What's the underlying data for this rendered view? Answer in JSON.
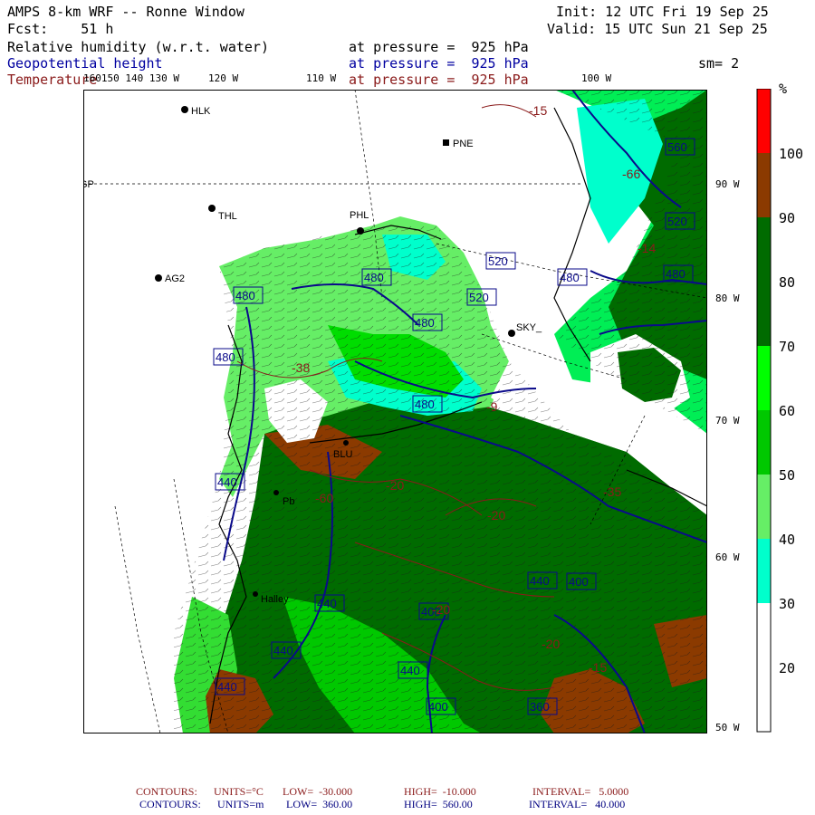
{
  "header": {
    "model": "AMPS 8-km WRF -- Ronne Window",
    "init": "Init: 12 UTC Fri 19 Sep 25",
    "forecast": "Fcst:    51 h",
    "valid": "Valid: 15 UTC Sun 21 Sep 25",
    "smoothing": "sm= 2"
  },
  "fields": [
    {
      "name": "Relative humidity (w.r.t. water)",
      "level": "at pressure =  925 hPa",
      "color": "#000000"
    },
    {
      "name": "Geopotential height",
      "level": "at pressure =  925 hPa",
      "color": "#0000a0"
    },
    {
      "name": "Temperature",
      "level": "at pressure =  925 hPa",
      "color": "#8a1a1a"
    }
  ],
  "lon_labels": [
    {
      "text": "160150 140 130 W"
    },
    {
      "text": "120 W"
    },
    {
      "text": "110 W"
    },
    {
      "text": "100 W"
    }
  ],
  "lat_labels": [
    "90 W",
    "80 W",
    "70 W",
    "60 W",
    "50 W"
  ],
  "stations": [
    {
      "id": "HLK",
      "label": "HLK"
    },
    {
      "id": "PNE",
      "label": "PNE"
    },
    {
      "id": "THL",
      "label": "THL"
    },
    {
      "id": "PHL",
      "label": "PHL"
    },
    {
      "id": "AG2",
      "label": "AG2"
    },
    {
      "id": "SKY",
      "label": "SKY_"
    },
    {
      "id": "BLU",
      "label": "BLU"
    },
    {
      "id": "PB",
      "label": "Pb"
    },
    {
      "id": "HAL",
      "label": "Halley"
    },
    {
      "id": "GP",
      "label": "GP"
    }
  ],
  "height_contour_labels": [
    "560",
    "520",
    "520",
    "520",
    "480",
    "480",
    "480",
    "480",
    "480",
    "480",
    "480",
    "440",
    "440",
    "440",
    "440",
    "440",
    "440",
    "400",
    "400",
    "400",
    "360"
  ],
  "temp_contour_labels": [
    "-15",
    "-66",
    "-14",
    "-38",
    "-20",
    "-20",
    "-20",
    "-20",
    "-15",
    "-9",
    "-60",
    "-35"
  ],
  "colorbar": {
    "unit": "%",
    "labels": [
      "100",
      "90",
      "80",
      "70",
      "60",
      "50",
      "40",
      "30",
      "20"
    ],
    "colors": {
      "90-100": "#ff0000",
      "80-90": "#8b3a00",
      "70-80": "#006b00",
      "60-70": "#00ff00",
      "50-60": "#00c800",
      "40-50": "#66ee66",
      "30-40": "#00ffcc",
      "20-30": "#ffffff",
      "lt20": "#ffffff"
    }
  },
  "footer": {
    "temp": {
      "label": "CONTOURS:",
      "units": "UNITS=°C",
      "low": "LOW=  -30.000",
      "high": "HIGH=  -10.000",
      "interval": "INTERVAL=   5.0000"
    },
    "height": {
      "label": "CONTOURS:",
      "units": "UNITS=m",
      "low": "LOW=  360.00",
      "high": "HIGH=  560.00",
      "interval": "INTERVAL=   40.000"
    }
  }
}
